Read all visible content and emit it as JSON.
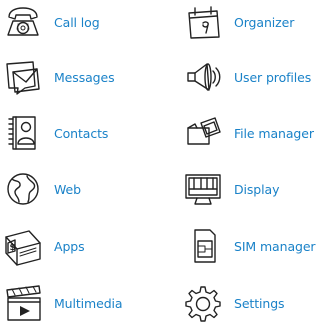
{
  "menu": {
    "items": [
      {
        "label": "Call log",
        "icon": "telephone-icon"
      },
      {
        "label": "Organizer",
        "icon": "calendar-icon"
      },
      {
        "label": "Messages",
        "icon": "envelope-icon"
      },
      {
        "label": "User profiles",
        "icon": "speaker-icon"
      },
      {
        "label": "Contacts",
        "icon": "address-book-icon"
      },
      {
        "label": "File manager",
        "icon": "folder-icon"
      },
      {
        "label": "Web",
        "icon": "globe-icon"
      },
      {
        "label": "Display",
        "icon": "monitor-icon"
      },
      {
        "label": "Apps",
        "icon": "apps-box-icon"
      },
      {
        "label": "SIM manager",
        "icon": "sim-card-icon"
      },
      {
        "label": "Multimedia",
        "icon": "clapperboard-icon"
      },
      {
        "label": "Settings",
        "icon": "gear-icon"
      }
    ]
  },
  "colors": {
    "label": "#1a82c8",
    "icon_stroke": "#222222",
    "background": "#ffffff"
  }
}
